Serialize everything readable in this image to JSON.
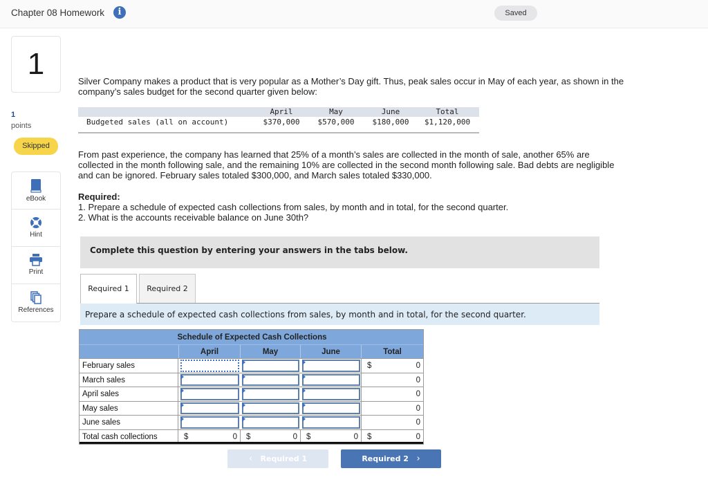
{
  "header": {
    "title": "Chapter 08 Homework",
    "info_icon": "info-icon",
    "saved_status": "Saved"
  },
  "question": {
    "number": "1",
    "points_value": "1",
    "points_label": "points",
    "status": "Skipped"
  },
  "tools": [
    {
      "label": "eBook",
      "icon": "book-icon"
    },
    {
      "label": "Hint",
      "icon": "lifebuoy-icon"
    },
    {
      "label": "Print",
      "icon": "printer-icon"
    },
    {
      "label": "References",
      "icon": "copy-documents-icon"
    }
  ],
  "problem": {
    "intro": "Silver Company makes a product that is very popular as a Mother’s Day gift. Thus, peak sales occur in May of each year, as shown in the company’s sales budget for the second quarter given below:",
    "budget": {
      "headers": [
        "April",
        "May",
        "June",
        "Total"
      ],
      "row_label": "Budgeted sales (all on account)",
      "values": [
        "$370,000",
        "$570,000",
        "$180,000",
        "$1,120,000"
      ]
    },
    "details": "From past experience, the company has learned that 25% of a month’s sales are collected in the month of sale, another 65% are collected in the month following sale, and the remaining 10% are collected in the second month following sale. Bad debts are negligible and can be ignored. February sales totaled $300,000, and March sales totaled $330,000.",
    "required_heading": "Required:",
    "required_items": [
      "1. Prepare a schedule of expected cash collections from sales, by month and in total, for the second quarter.",
      "2. What is the accounts receivable balance on June 30th?"
    ]
  },
  "instruction": "Complete this question by entering your answers in the tabs below.",
  "tabs": [
    {
      "label": "Required 1",
      "active": true
    },
    {
      "label": "Required 2",
      "active": false
    }
  ],
  "tab_prompt": "Prepare a schedule of expected cash collections from sales, by month and in total, for the second quarter.",
  "schedule": {
    "title": "Schedule of Expected Cash Collections",
    "columns": [
      "April",
      "May",
      "June",
      "Total"
    ],
    "rows": [
      {
        "label": "February sales",
        "inputs": [
          "",
          "",
          ""
        ],
        "total_prefix": "$",
        "total": "0"
      },
      {
        "label": "March sales",
        "inputs": [
          "",
          "",
          ""
        ],
        "total_prefix": "",
        "total": "0"
      },
      {
        "label": "April sales",
        "inputs": [
          "",
          "",
          ""
        ],
        "total_prefix": "",
        "total": "0"
      },
      {
        "label": "May sales",
        "inputs": [
          "",
          "",
          ""
        ],
        "total_prefix": "",
        "total": "0"
      },
      {
        "label": "June sales",
        "inputs": [
          "",
          "",
          ""
        ],
        "total_prefix": "",
        "total": "0"
      }
    ],
    "total_row": {
      "label": "Total cash collections",
      "currency": "$",
      "values": [
        "0",
        "0",
        "0",
        "0"
      ]
    }
  },
  "nav": {
    "prev_label": "Required 1",
    "next_label": "Required 2",
    "prev_chevron": "‹",
    "next_chevron": "›"
  }
}
